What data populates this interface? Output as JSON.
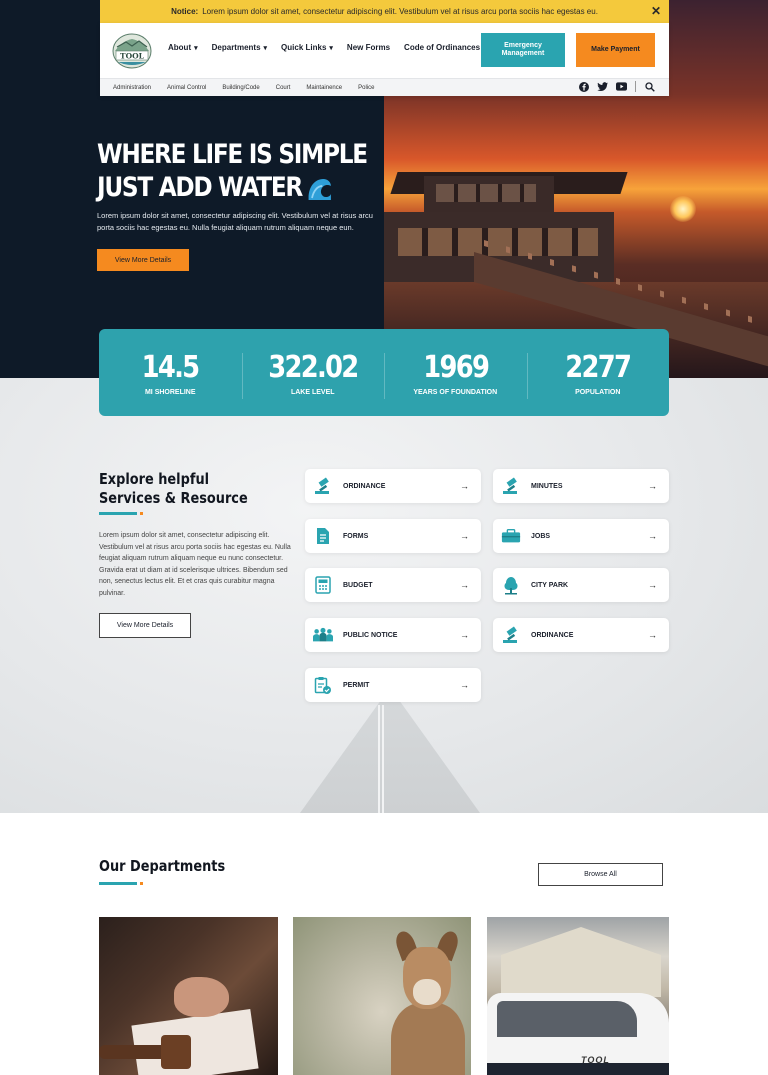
{
  "notice": {
    "label": "Notice:",
    "text": "Lorem ipsum dolor sit amet, consectetur adipiscing elit. Vestibulum vel at risus arcu porta sociis hac egestas eu."
  },
  "logo": {
    "text": "TOOL"
  },
  "nav": {
    "items": [
      {
        "label": "About",
        "caret": true
      },
      {
        "label": "Departments",
        "caret": true
      },
      {
        "label": "Quick Links",
        "caret": true
      },
      {
        "label": "New Forms",
        "caret": false
      },
      {
        "label": "Code of Ordinances",
        "caret": false
      }
    ],
    "emergency_label": "Emergency Management",
    "payment_label": "Make Payment"
  },
  "subnav": [
    "Administration",
    "Animal Control",
    "Building/Code",
    "Court",
    "Maintainence",
    "Police"
  ],
  "social_icons": [
    "facebook-icon",
    "twitter-icon",
    "youtube-icon",
    "search-icon"
  ],
  "hero": {
    "title_line1": "WHERE LIFE IS SIMPLE",
    "title_line2": "JUST ADD WATER",
    "text": "Lorem ipsum dolor sit amet, consectetur adipiscing elit. Vestibulum vel at risus arcu porta sociis hac egestas eu. Nulla feugiat aliquam rutrum aliquam neque eun.",
    "button_label": "View More Details"
  },
  "stats": [
    {
      "value": "14.5",
      "label": "MI SHORELINE"
    },
    {
      "value": "322.02",
      "label": "LAKE LEVEL"
    },
    {
      "value": "1969",
      "label": "YEARS OF FOUNDATION"
    },
    {
      "value": "2277",
      "label": "POPULATION"
    }
  ],
  "services": {
    "title": "Explore helpful Services & Resource",
    "text": "Lorem ipsum dolor sit amet, consectetur adipiscing elit. Vestibulum vel at risus arcu porta sociis hac egestas eu. Nulla feugiat aliquam rutrum aliquam neque eu nunc consectetur. Gravida erat ut diam at id scelerisque ultrices. Bibendum sed non, senectus lectus elit. Et et cras quis curabitur magna pulvinar.",
    "button_label": "View More Details",
    "cards": [
      {
        "label": "ORDINANCE",
        "icon": "gavel-icon"
      },
      {
        "label": "MINUTES",
        "icon": "gavel-icon"
      },
      {
        "label": "FORMS",
        "icon": "document-icon"
      },
      {
        "label": "JOBS",
        "icon": "briefcase-icon"
      },
      {
        "label": "BUDGET",
        "icon": "calculator-icon"
      },
      {
        "label": "CITY PARK",
        "icon": "tree-icon"
      },
      {
        "label": "PUBLIC NOTICE",
        "icon": "people-icon"
      },
      {
        "label": "ORDINANCE",
        "icon": "gavel-icon"
      },
      {
        "label": "PERMIT",
        "icon": "clipboard-check-icon"
      }
    ],
    "arrow": "→"
  },
  "departments": {
    "title": "Our Departments",
    "button_label": "Browse All",
    "car_text": "TOOL"
  },
  "colors": {
    "accent": "#2aa4b0",
    "orange": "#f58a1f",
    "notice": "#f4c93c",
    "navy": "#0e1a28"
  }
}
